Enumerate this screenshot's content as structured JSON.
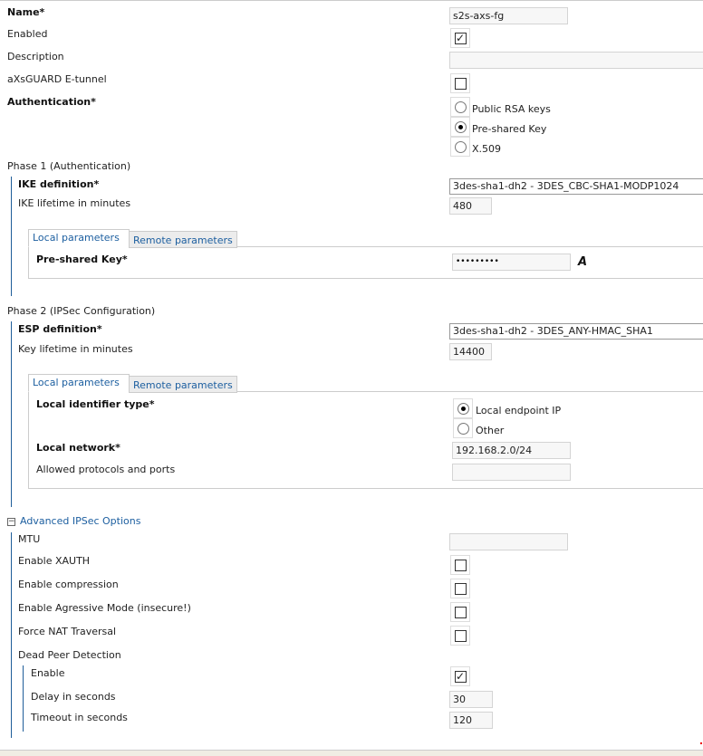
{
  "general": {
    "name_label": "Name*",
    "name_value": "s2s-axs-fg",
    "enabled_label": "Enabled",
    "enabled": true,
    "description_label": "Description",
    "description_value": "",
    "etunnel_label": "aXsGUARD E-tunnel",
    "etunnel": false,
    "auth_label": "Authentication*",
    "auth_options": [
      "Public RSA keys",
      "Pre-shared Key",
      "X.509"
    ],
    "auth_selected": "Pre-shared Key"
  },
  "phase1": {
    "title": "Phase 1 (Authentication)",
    "ike_label": "IKE definition*",
    "ike_value": "3des-sha1-dh2 - 3DES_CBC-SHA1-MODP1024",
    "lifetime_label": "IKE lifetime in minutes",
    "lifetime_value": "480",
    "tabs": [
      "Local parameters",
      "Remote parameters"
    ],
    "psk_label": "Pre-shared Key*",
    "psk_value": "•••••••••",
    "psk_toggle_icon": "A"
  },
  "phase2": {
    "title": "Phase 2 (IPSec Configuration)",
    "esp_label": "ESP definition*",
    "esp_value": "3des-sha1-dh2 - 3DES_ANY-HMAC_SHA1",
    "lifetime_label": "Key lifetime in minutes",
    "lifetime_value": "14400",
    "tabs": [
      "Local parameters",
      "Remote parameters"
    ],
    "idtype_label": "Local identifier type*",
    "idtype_options": [
      "Local endpoint IP",
      "Other"
    ],
    "idtype_selected": "Local endpoint IP",
    "network_label": "Local network*",
    "network_value": "192.168.2.0/24",
    "protocols_label": "Allowed protocols and ports",
    "protocols_value": ""
  },
  "advanced": {
    "title": "Advanced IPSec Options",
    "mtu_label": "MTU",
    "mtu_value": "",
    "xauth_label": "Enable XAUTH",
    "compression_label": "Enable compression",
    "aggressive_label": "Enable Agressive Mode (insecure!)",
    "nat_label": "Force NAT Traversal",
    "dpd_label": "Dead Peer Detection",
    "dpd_enable_label": "Enable",
    "dpd_enabled": true,
    "delay_label": "Delay in seconds",
    "delay_value": "30",
    "timeout_label": "Timeout in seconds",
    "timeout_value": "120"
  }
}
